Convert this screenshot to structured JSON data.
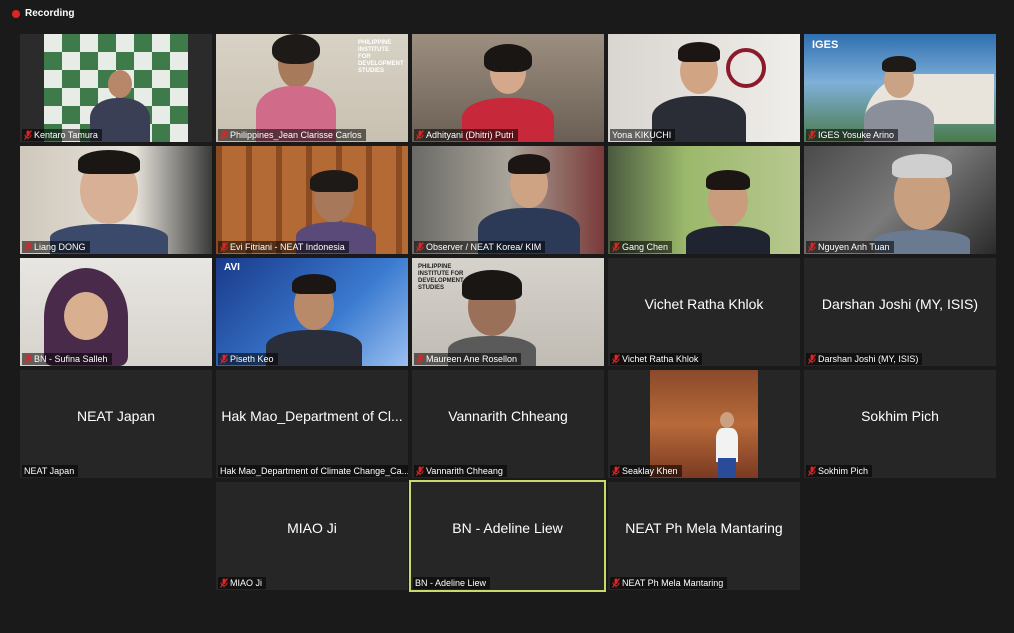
{
  "recording": {
    "label": "Recording"
  },
  "colors": {
    "active_border": "#c9d96a",
    "rec_red": "#e02424",
    "mute_red": "#e02424"
  },
  "tiles": [
    {
      "name": "Kentaro Tamura",
      "muted": true,
      "video": true
    },
    {
      "name": "Philippines_Jean Clarisse Carlos",
      "muted": true,
      "video": true
    },
    {
      "name": "Adhityani (Dhitri) Putri",
      "muted": true,
      "video": true
    },
    {
      "name": "Yona KIKUCHI",
      "muted": false,
      "video": true
    },
    {
      "name": "IGES Yosuke Arino",
      "muted": true,
      "video": true
    },
    {
      "name": "Liang DONG",
      "muted": true,
      "video": true
    },
    {
      "name": "Evi Fitriani - NEAT Indonesia",
      "muted": true,
      "video": true
    },
    {
      "name": "Observer / NEAT Korea/ KIM",
      "muted": true,
      "video": true
    },
    {
      "name": "Gang Chen",
      "muted": true,
      "video": true
    },
    {
      "name": "Nguyen Anh Tuan",
      "muted": true,
      "video": true
    },
    {
      "name": "BN - Sufina Salleh",
      "muted": true,
      "video": true
    },
    {
      "name": "Piseth Keo",
      "muted": true,
      "video": true
    },
    {
      "name": "Maureen Ane Rosellon",
      "muted": true,
      "video": true
    },
    {
      "name": "Vichet Ratha Khlok",
      "muted": true,
      "video": false,
      "display": "Vichet Ratha Khlok"
    },
    {
      "name": "Darshan Joshi (MY, ISIS)",
      "muted": true,
      "video": false,
      "display": "Darshan Joshi (MY, ISIS)"
    },
    {
      "name": "NEAT Japan",
      "muted": false,
      "video": false,
      "display": "NEAT Japan"
    },
    {
      "name": "Hak Mao_Department of Climate Change_Ca...",
      "muted": false,
      "video": false,
      "display": "Hak Mao_Department of Cl..."
    },
    {
      "name": "Vannarith Chheang",
      "muted": true,
      "video": false,
      "display": "Vannarith Chheang"
    },
    {
      "name": "Seaklay Khen",
      "muted": true,
      "video": true
    },
    {
      "name": "Sokhim Pich",
      "muted": true,
      "video": false,
      "display": "Sokhim Pich"
    },
    {
      "name": "MIAO Ji",
      "muted": true,
      "video": false,
      "display": "MIAO Ji"
    },
    {
      "name": "BN - Adeline Liew",
      "muted": false,
      "video": false,
      "display": "BN - Adeline Liew",
      "active": true
    },
    {
      "name": "NEAT Ph Mela Mantaring",
      "muted": true,
      "video": false,
      "display": "NEAT Ph Mela Mantaring"
    }
  ]
}
